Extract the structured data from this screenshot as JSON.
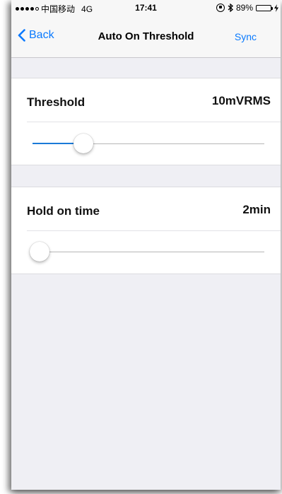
{
  "status_bar": {
    "carrier": "中国移动",
    "network": "4G",
    "time": "17:41",
    "battery_text": "89%",
    "icons": [
      "signal-dots-icon",
      "rotation-lock-icon",
      "bluetooth-icon",
      "battery-icon",
      "charging-icon"
    ]
  },
  "nav": {
    "back_label": "Back",
    "title": "Auto On Threshold",
    "sync_label": "Sync"
  },
  "threshold": {
    "label": "Threshold",
    "value_text": "10mVRMS",
    "slider_fraction": 0.22
  },
  "hold_on_time": {
    "label": "Hold on time",
    "value_text": "2min",
    "slider_fraction": 0.03
  },
  "colors": {
    "accent": "#0a7afe",
    "slider_fill": "#1a7ad8",
    "background": "#efeff4",
    "battery": "#4cd964"
  }
}
